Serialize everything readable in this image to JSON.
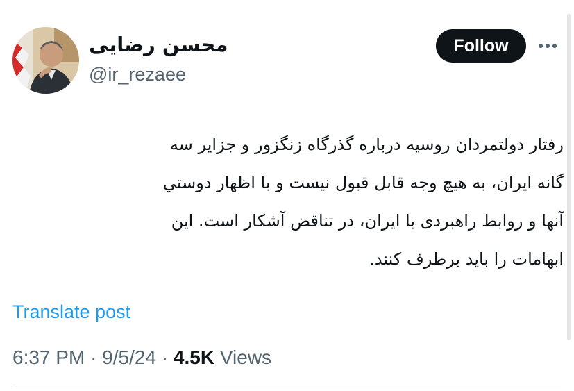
{
  "author": {
    "display_name": "محسن رضایی",
    "handle": "@ir_rezaee",
    "avatar_icon": "profile-photo"
  },
  "actions": {
    "follow_label": "Follow",
    "more_icon": "more-horizontal-icon"
  },
  "tweet": {
    "lines": [
      "رفتار دولتمردان روسیه درباره گذرگاه زنگزور و جزایر سه",
      "گانه ایران، به هیچ وجه قابل قبول نیست و با اظهار دوستي",
      "آنها و روابط راهبردی با ایران، در تناقض آشکار است. این",
      "ابهامات را باید برطرف کنند."
    ]
  },
  "translate_label": "Translate post",
  "meta": {
    "time": "6:37 PM",
    "separator": "·",
    "date": "9/5/24",
    "views_count": "4.5K",
    "views_label": "Views"
  },
  "colors": {
    "text": "#0f1419",
    "secondary": "#536471",
    "link": "#1d9bf0",
    "button_bg": "#0f1419",
    "button_text": "#ffffff",
    "divider": "#cfd9de"
  }
}
